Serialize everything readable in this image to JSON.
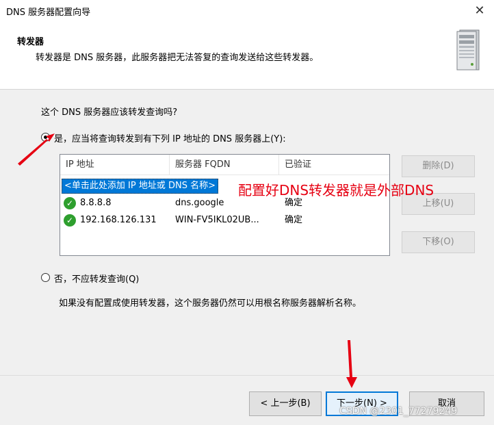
{
  "window": {
    "title": "DNS 服务器配置向导",
    "close_glyph": "✕"
  },
  "header": {
    "title": "转发器",
    "description": "转发器是 DNS 服务器，此服务器把无法答复的查询发送给这些转发器。"
  },
  "question": "这个 DNS 服务器应该转发查询吗?",
  "option_yes": {
    "label": "是，应当将查询转发到有下列 IP 地址的 DNS 服务器上(Y):",
    "selected": true
  },
  "forwarders": {
    "columns": [
      "IP 地址",
      "服务器 FQDN",
      "已验证"
    ],
    "add_placeholder": "<单击此处添加 IP 地址或 DNS 名称>",
    "rows": [
      {
        "ip": "8.8.8.8",
        "fqdn": "dns.google",
        "verified": "确定"
      },
      {
        "ip": "192.168.126.131",
        "fqdn": "WIN-FV5IKL02UB...",
        "verified": "确定"
      }
    ]
  },
  "side_buttons": {
    "delete": "删除(D)",
    "up": "上移(U)",
    "down": "下移(O)"
  },
  "annotation": "配置好DNS转发器就是外部DNS",
  "option_no": {
    "label": "否，不应转发查询(Q)",
    "selected": false
  },
  "note": "如果没有配置成使用转发器，这个服务器仍然可以用根名称服务器解析名称。",
  "buttons": {
    "back": "< 上一步(B)",
    "next": "下一步(N) >",
    "cancel": "取消"
  },
  "watermark": "CSDN @2301_77279249",
  "colors": {
    "annotation": "#e60012",
    "selection": "#0078d7",
    "check": "#2e9f2e",
    "focus": "#0078d7"
  }
}
